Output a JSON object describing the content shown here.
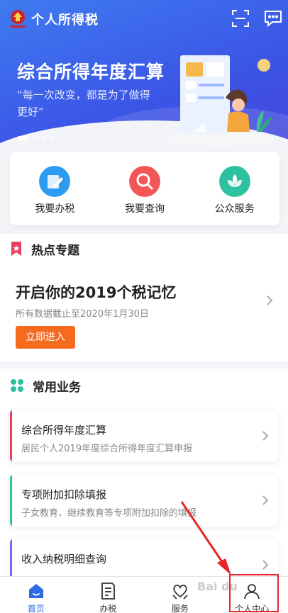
{
  "header": {
    "title": "个人所得税",
    "scan_icon": "scan-icon",
    "message_icon": "message-icon"
  },
  "banner": {
    "title": "综合所得年度汇算",
    "quote": "“每一次改变，都是为了做得更好”",
    "slides": 4,
    "active_slide": 1
  },
  "quick_actions": [
    {
      "label": "我要办税",
      "icon": "pencil-icon",
      "color": "#2d9cf0"
    },
    {
      "label": "我要查询",
      "icon": "search-icon",
      "color": "#f25656"
    },
    {
      "label": "公众服务",
      "icon": "flower-icon",
      "color": "#2ec1a0"
    }
  ],
  "hot_topics": {
    "section_title": "热点专题",
    "headline": "开启你的2019个税记忆",
    "subtitle": "所有数据截止至2020年1月30日",
    "button": "立即进入"
  },
  "services": {
    "section_title": "常用业务",
    "items": [
      {
        "title": "综合所得年度汇算",
        "desc": "居民个人2019年度综合所得年度汇算申报",
        "color": "#e8415e"
      },
      {
        "title": "专项附加扣除填报",
        "desc": "子女教育、继续教育等专项附加扣除的填报",
        "color": "#2ec1a0"
      },
      {
        "title": "收入纳税明细查询",
        "desc": "",
        "color": "#7b68ee"
      }
    ]
  },
  "tabbar": {
    "items": [
      {
        "label": "首页",
        "icon": "home-icon",
        "active": true
      },
      {
        "label": "办税",
        "icon": "document-icon",
        "active": false
      },
      {
        "label": "服务",
        "icon": "heart-hands-icon",
        "active": false
      },
      {
        "label": "个人中心",
        "icon": "person-icon",
        "active": false
      }
    ]
  },
  "watermark": "Bai du"
}
